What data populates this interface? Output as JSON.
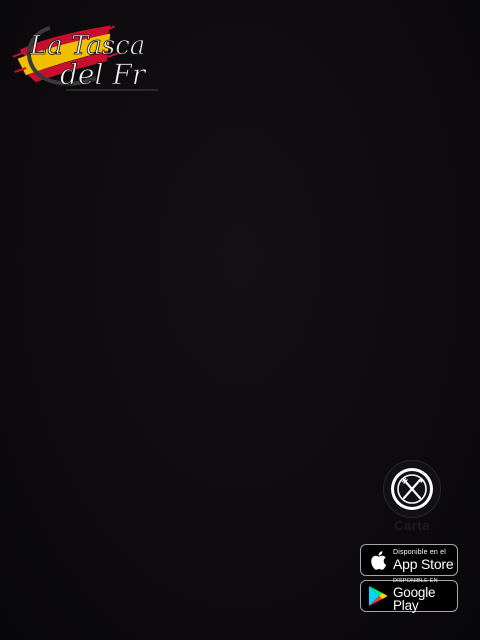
{
  "logo": {
    "line1": "La Tasca",
    "line2": "del Fr",
    "colors": {
      "red": "#c8102e",
      "yellow": "#f1bf00"
    }
  },
  "menu_button": {
    "label": "Carta",
    "icon": "fork-knife-icon"
  },
  "badges": {
    "app_store": {
      "small": "Disponible en el",
      "big": "App Store",
      "icon": "apple-icon"
    },
    "google_play": {
      "small": "DISPONIBLE EN",
      "big": "Google Play",
      "icon": "google-play-icon"
    }
  }
}
